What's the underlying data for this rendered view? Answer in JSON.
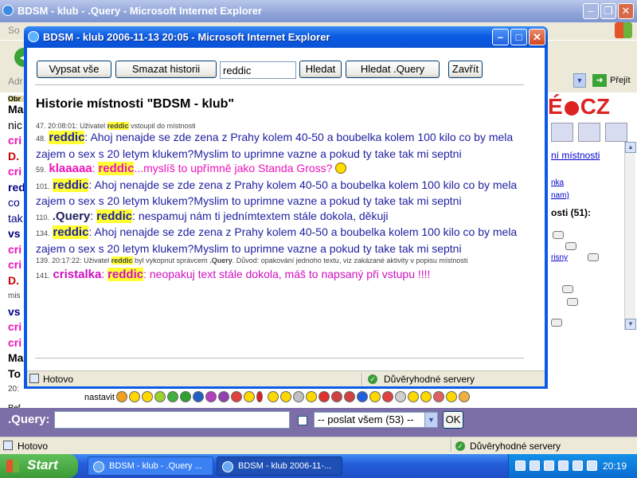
{
  "background_window": {
    "title": "BDSM - klub - .Query - Microsoft Internet Explorer",
    "menu_left": "So",
    "address_label": "Adr",
    "go_label": "Přejít",
    "left_fragments": [
      {
        "text": "Obr",
        "color": "#000000"
      },
      {
        "text": "Ma",
        "color": "#000000"
      },
      {
        "text": "nic",
        "color": "#000000"
      },
      {
        "text": "cri",
        "color": "#ee11bb"
      },
      {
        "text": "D.",
        "color": "#cc0000"
      },
      {
        "text": "cri",
        "color": "#ee11bb"
      },
      {
        "text": "red",
        "color": "#000080"
      },
      {
        "text": "co",
        "color": "#000080"
      },
      {
        "text": "tak",
        "color": "#000080"
      },
      {
        "text": "vs",
        "color": "#000080"
      },
      {
        "text": "cri",
        "color": "#ee11bb"
      },
      {
        "text": "cri",
        "color": "#ee11bb"
      },
      {
        "text": "D.",
        "color": "#cc0000"
      },
      {
        "text": "mis",
        "color": "#444444"
      },
      {
        "text": "vs",
        "color": "#000080"
      },
      {
        "text": "cri",
        "color": "#ee11bb"
      },
      {
        "text": "cri",
        "color": "#ee11bb"
      },
      {
        "text": "Ma",
        "color": "#000000"
      },
      {
        "text": "To",
        "color": "#000000"
      },
      {
        "text": "20:",
        "color": "#444444"
      },
      {
        "text": "Ref",
        "color": "#000000"
      }
    ],
    "right_panel": {
      "link_room": "ní místnosti",
      "link_nick1": "nka",
      "link_nick2": "nam)",
      "users_label": "osti (51):",
      "link_user": "risny"
    },
    "emoticon_label": "nastavit",
    "query_label": ".Query:",
    "send_select": "-- poslat všem (53) --",
    "ok_button": "OK",
    "status_text": "Hotovo",
    "trust_text": "Důvěryhodné servery"
  },
  "popup": {
    "title": "BDSM - klub 2006-11-13 20:05 - Microsoft Internet Explorer",
    "buttons": {
      "list_all": "Vypsat vše",
      "delete_history": "Smazat historii",
      "search": "Hledat",
      "search_query": "Hledat .Query",
      "close": "Zavřít"
    },
    "search_value": "reddic",
    "heading": "Historie místnosti \"BDSM - klub\"",
    "messages": {
      "m47": {
        "num": "47. 20:08:01:",
        "pre": "Uživatel",
        "nick": "reddic",
        "post": "vstoupil do místnosti"
      },
      "m48": {
        "num": "48.",
        "author": "reddic",
        "sep": ":",
        "text": "Ahoj nenajde se zde zena z Prahy kolem 40-50 a boubelka kolem 100 kilo co by mela zajem o sex s 20 letym klukem?Myslim to uprimne vazne a pokud ty take tak mi septni"
      },
      "m59": {
        "num": "59.",
        "author": "klaaaaa",
        "sep": ":",
        "target": "reddic",
        "text": "...myslíš to upřímně jako Standa Gross?"
      },
      "m101": {
        "num": "101.",
        "author": "reddic",
        "sep": ":",
        "text": "Ahoj nenajde se zde zena z Prahy kolem 40-50 a boubelka kolem 100 kilo co by mela zajem o sex s 20 letym klukem?Myslim to uprimne vazne a pokud ty take tak mi septni"
      },
      "m110": {
        "num": "110.",
        "author": ".Query",
        "sep": ":",
        "target": "reddic",
        "text": ": nespamuj nám ti jednímtextem stále dokola, děkuji"
      },
      "m134": {
        "num": "134.",
        "author": "reddic",
        "sep": ":",
        "text": "Ahoj nenajde se zde zena z Prahy kolem 40-50 a boubelka kolem 100 kilo co by mela zajem o sex s 20 letym klukem?Myslim to uprimne vazne a pokud ty take tak mi septni"
      },
      "m139": {
        "num": "139. 20:17:22:",
        "pre": "Uživatel",
        "nick": "reddic",
        "mid": "byl vykopnut správcem",
        "admin": ".Query",
        "reason": ". Důvod: opakování jednoho textu, viz zakázané aktivity v popisu místnosti"
      },
      "m141": {
        "num": "141.",
        "author": "cristalka",
        "sep": ":",
        "target": "reddic",
        "text": ": neopakuj text stále dokola, máš to napsaný při vstupu !!!!"
      }
    },
    "status_text": "Hotovo",
    "trust_text": "Důvěryhodné servery"
  },
  "taskbar": {
    "start": "Start",
    "task1": "BDSM - klub - .Query ...",
    "task2": "BDSM - klub 2006-11-...",
    "clock": "20:19"
  }
}
